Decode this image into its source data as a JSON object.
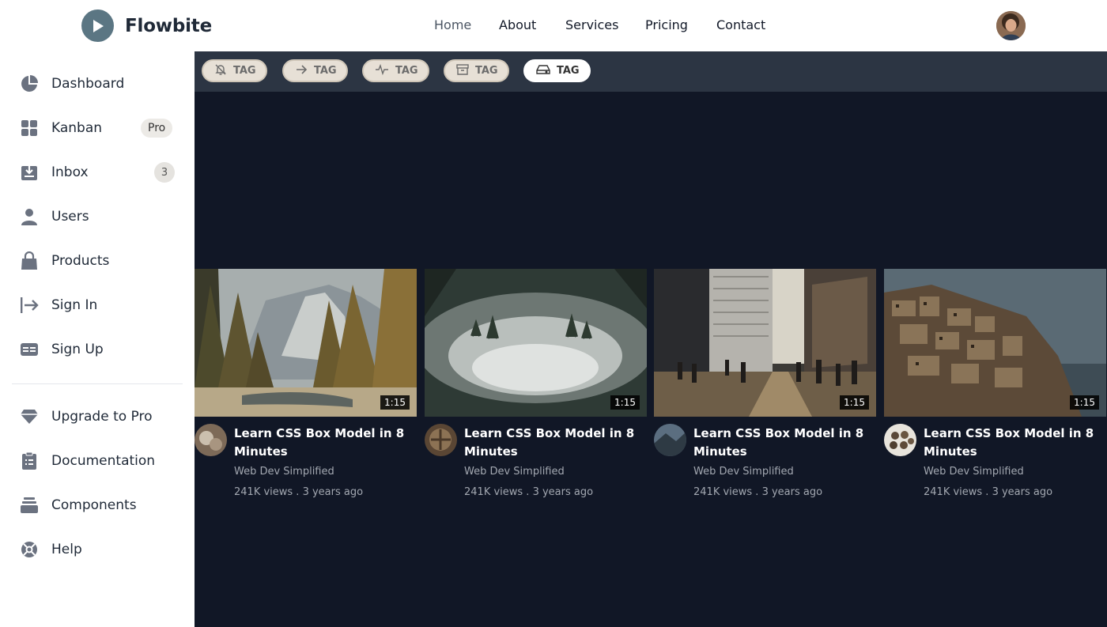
{
  "brand": {
    "name": "Flowbite",
    "logo_icon": "play-icon"
  },
  "nav": {
    "links": [
      {
        "label": "Home",
        "active": true
      },
      {
        "label": "About"
      },
      {
        "label": "Services"
      },
      {
        "label": "Pricing"
      },
      {
        "label": "Contact"
      }
    ]
  },
  "user": {
    "avatar": "user-avatar"
  },
  "sidebar": {
    "items": [
      {
        "label": "Dashboard",
        "icon": "pie-chart-icon"
      },
      {
        "label": "Kanban",
        "icon": "grid-icon",
        "badge": "Pro"
      },
      {
        "label": "Inbox",
        "icon": "inbox-icon",
        "count": "3"
      },
      {
        "label": "Users",
        "icon": "user-icon"
      },
      {
        "label": "Products",
        "icon": "shopping-bag-icon"
      },
      {
        "label": "Sign In",
        "icon": "sign-in-icon"
      },
      {
        "label": "Sign Up",
        "icon": "sign-up-icon"
      }
    ],
    "secondary": [
      {
        "label": "Upgrade to Pro",
        "icon": "diamond-icon"
      },
      {
        "label": "Documentation",
        "icon": "clipboard-icon"
      },
      {
        "label": "Components",
        "icon": "layers-icon"
      },
      {
        "label": "Help",
        "icon": "lifebuoy-icon"
      }
    ]
  },
  "tags": [
    {
      "label": "TAG",
      "icon": "bell-off-icon"
    },
    {
      "label": "TAG",
      "icon": "arrow-right-icon"
    },
    {
      "label": "TAG",
      "icon": "activity-icon"
    },
    {
      "label": "TAG",
      "icon": "archive-icon"
    },
    {
      "label": "TAG",
      "icon": "hard-drive-icon",
      "active": true
    }
  ],
  "videos": [
    {
      "title": "Learn CSS Box Model in 8 Minutes",
      "channel": "Web Dev Simplified",
      "meta": "241K views . 3 years ago",
      "duration": "1:15"
    },
    {
      "title": "Learn CSS Box Model in 8 Minutes",
      "channel": "Web Dev Simplified",
      "meta": "241K views . 3 years ago",
      "duration": "1:15"
    },
    {
      "title": "Learn CSS Box Model in 8 Minutes",
      "channel": "Web Dev Simplified",
      "meta": "241K views . 3 years ago",
      "duration": "1:15"
    },
    {
      "title": "Learn CSS Box Model in 8 Minutes",
      "channel": "Web Dev Simplified",
      "meta": "241K views . 3 years ago",
      "duration": "1:15"
    }
  ],
  "colors": {
    "main_bg": "#111726",
    "tagbar_bg": "#2c3543",
    "logo": "#5b7683",
    "icon": "#6b7280"
  }
}
